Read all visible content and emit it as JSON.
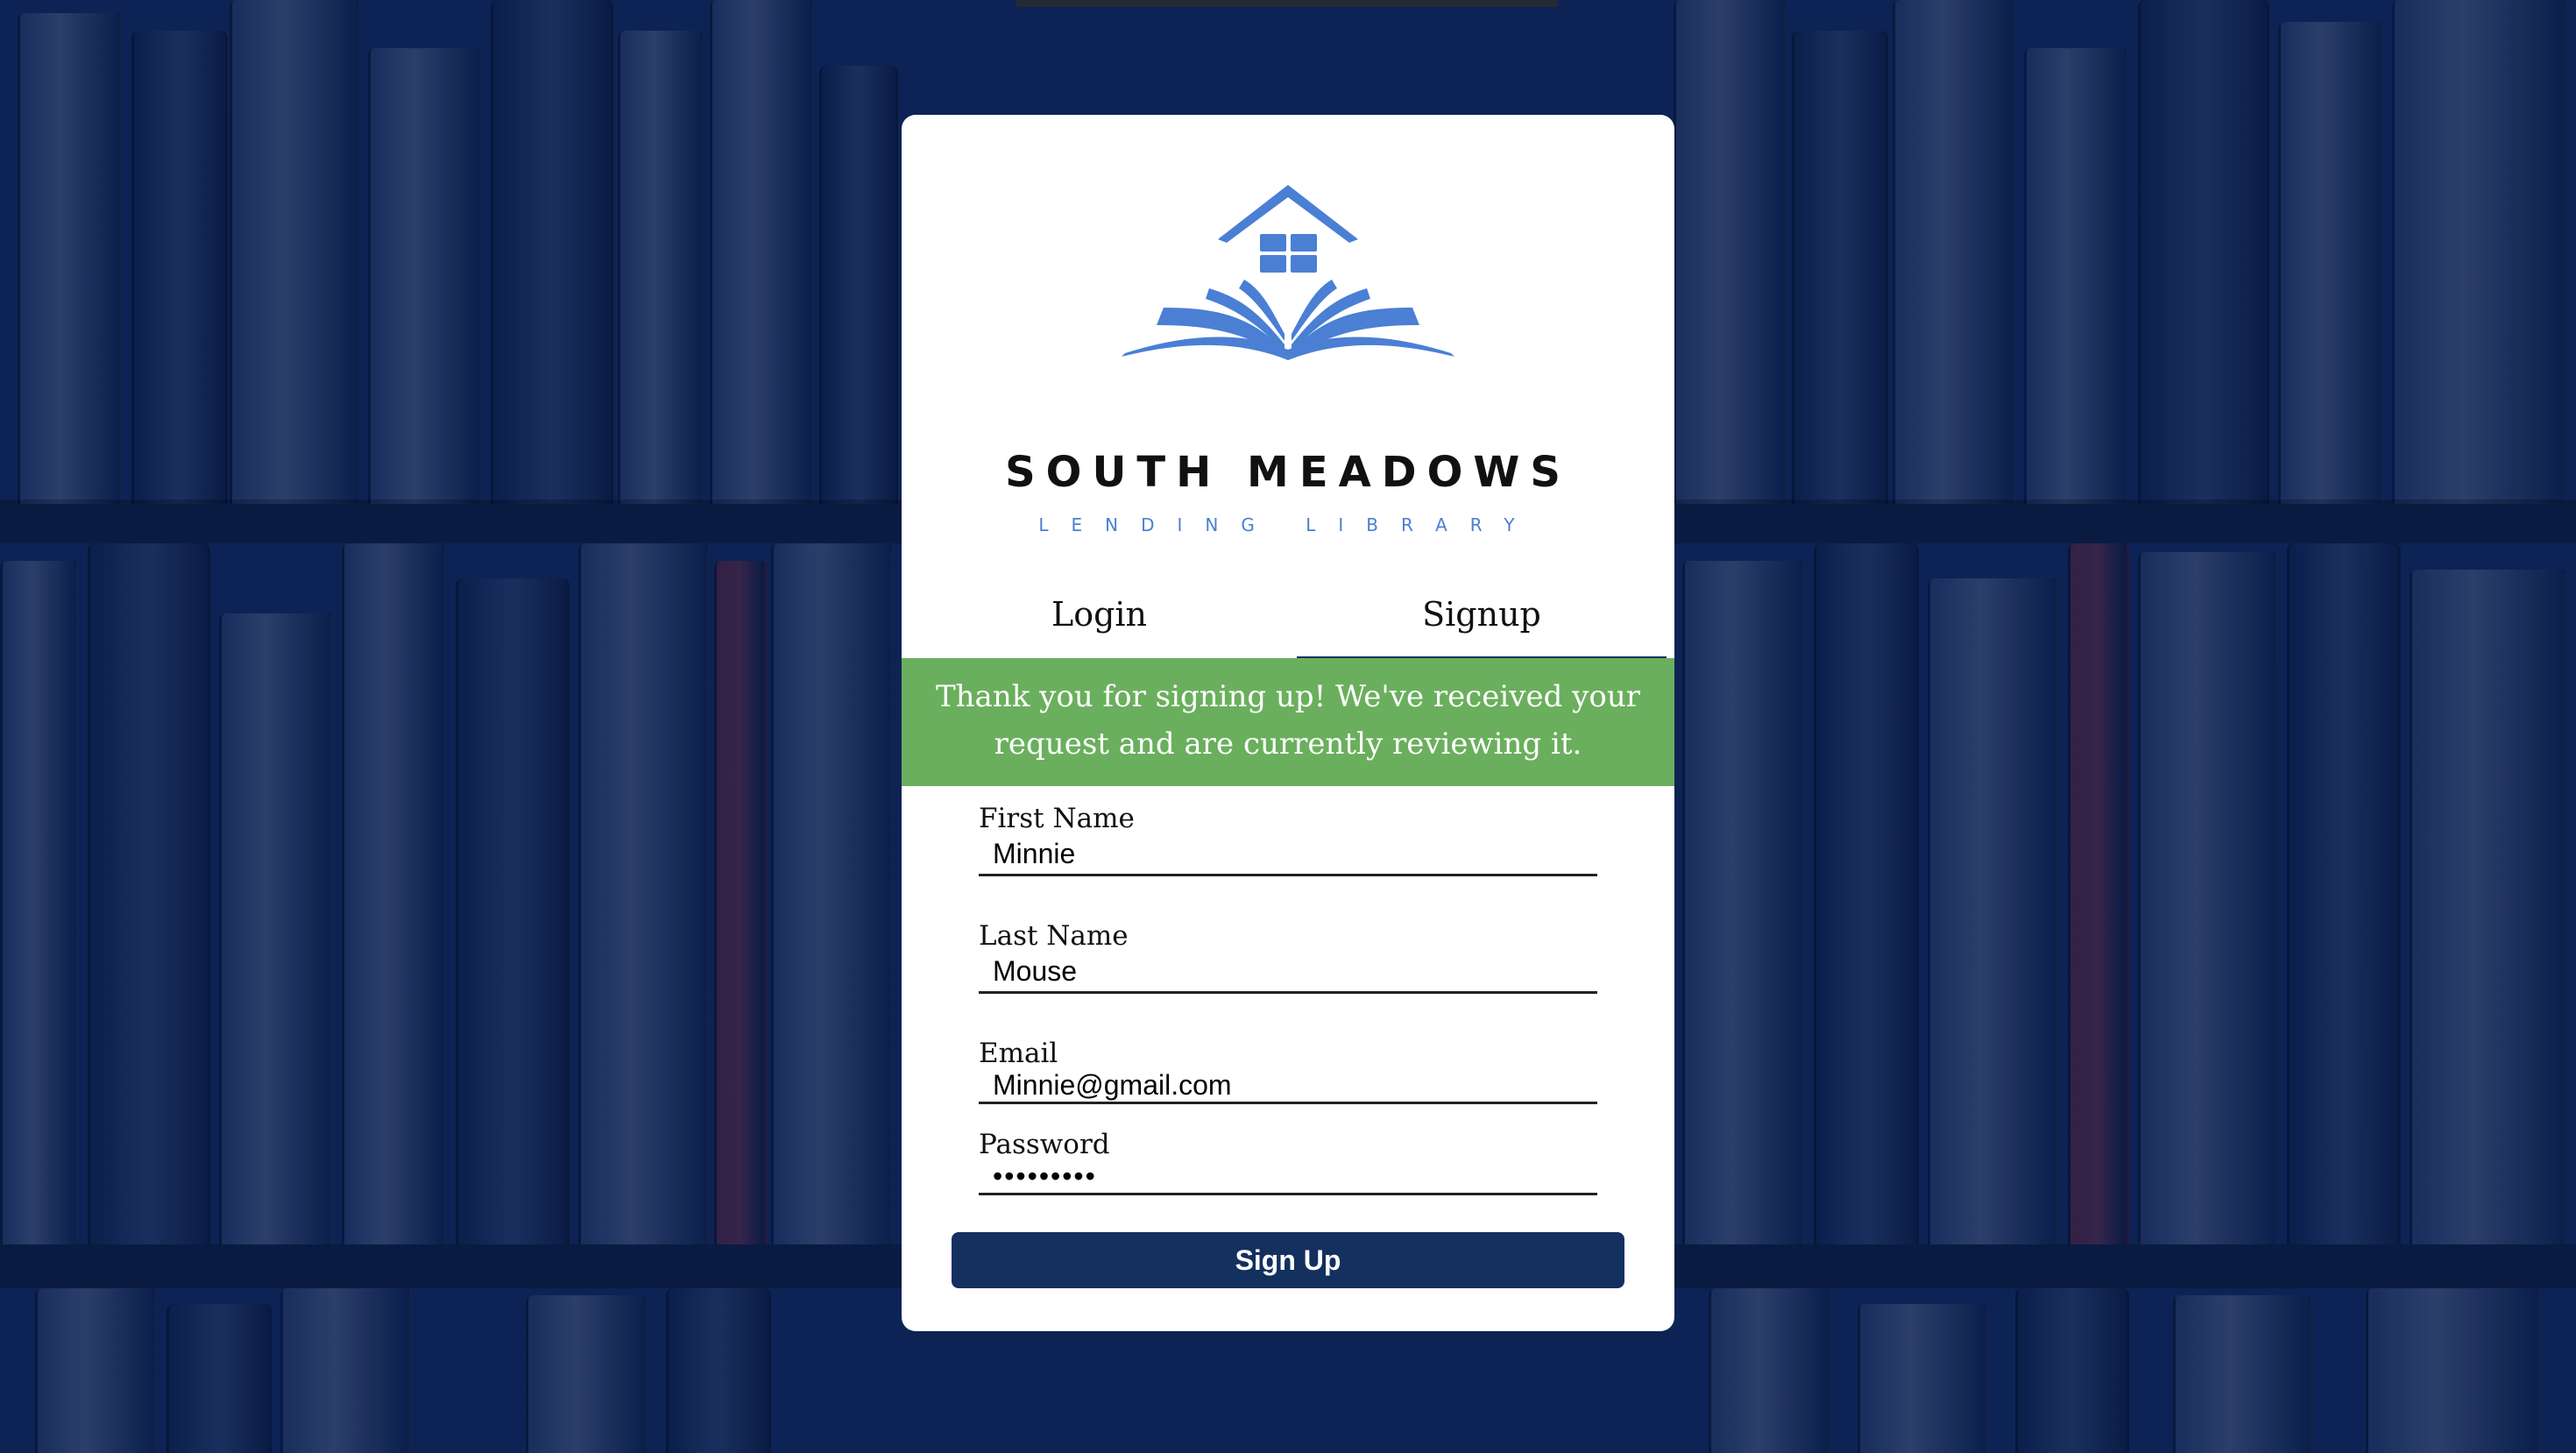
{
  "brand": {
    "title": "SOUTH MEADOWS",
    "subtitle": "LENDING LIBRARY",
    "logo_icon": "house-book-logo"
  },
  "tabs": [
    {
      "label": "Login",
      "active": false
    },
    {
      "label": "Signup",
      "active": true
    }
  ],
  "banner": {
    "message": "Thank you for signing up! We've received your request and are currently reviewing it."
  },
  "form": {
    "first_name": {
      "label": "First Name",
      "value": "Minnie"
    },
    "last_name": {
      "label": "Last Name",
      "value": "Mouse"
    },
    "email": {
      "label": "Email",
      "value": "Minnie@gmail.com"
    },
    "password": {
      "label": "Password",
      "value": "•••••••••"
    },
    "submit_label": "Sign Up"
  },
  "colors": {
    "background": "#0d2355",
    "accent": "#13305f",
    "success": "#6aaf5d",
    "logo_blue": "#4a7fd4"
  }
}
